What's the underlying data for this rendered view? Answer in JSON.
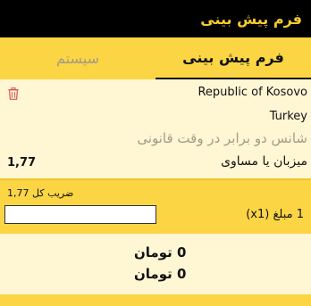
{
  "header": {
    "title": "فرم پیش بینی"
  },
  "tabs": [
    {
      "label": "فرم پیش بینی",
      "active": true
    },
    {
      "label": "سیستم",
      "active": false
    }
  ],
  "bet": {
    "event_home": "Republic of Kosovo",
    "event_away": "Turkey",
    "market": "شانس دو برابر در وقت قانونی",
    "selection": "میزبان یا مساوی",
    "odds": "1,77",
    "delete_icon": "trash-icon"
  },
  "stake": {
    "total_odds_label": "ضریب کل",
    "total_odds_value": "1,77",
    "amount_label": "1 مبلغ (x1)",
    "amount_value": ""
  },
  "results": [
    {
      "text": "0 تومان"
    },
    {
      "text": "0 تومان"
    }
  ],
  "colors": {
    "accent": "#fbd544",
    "background": "#fff6d4",
    "topbar": "#000000",
    "title": "#f7cb2f",
    "delete": "#d9534f"
  }
}
